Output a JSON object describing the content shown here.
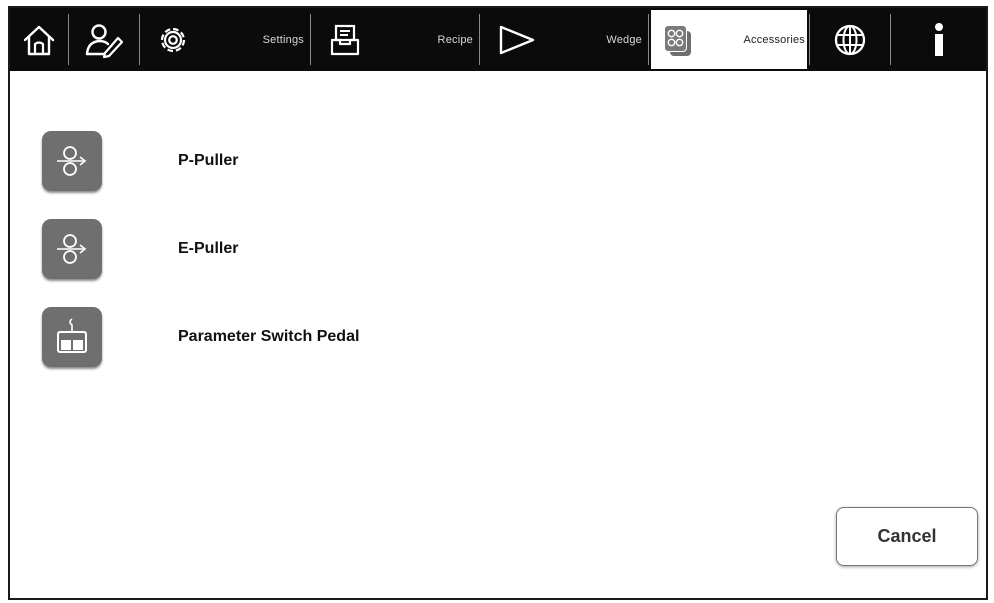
{
  "toolbar": {
    "home_icon": "home-icon",
    "user_icon": "user-edit-icon",
    "settings": {
      "icon": "gear-icon",
      "label": "Settings"
    },
    "recipe": {
      "icon": "tray-icon",
      "label": "Recipe"
    },
    "wedge": {
      "icon": "play-icon",
      "label": "Wedge"
    },
    "accessories": {
      "icon": "accessories-icon",
      "label": "Accessories",
      "active": true
    },
    "language_icon": "globe-icon",
    "info_icon": "info-icon"
  },
  "accessories": [
    {
      "label": "P-Puller",
      "icon": "puller-icon"
    },
    {
      "label": "E-Puller",
      "icon": "puller-icon"
    },
    {
      "label": "Parameter Switch Pedal",
      "icon": "pedal-icon"
    }
  ],
  "cancel_label": "Cancel",
  "colors": {
    "toolbar_bg": "#0b0b0b",
    "tile_bg": "#6f6f6f",
    "active_tab_bg": "#ffffff"
  }
}
